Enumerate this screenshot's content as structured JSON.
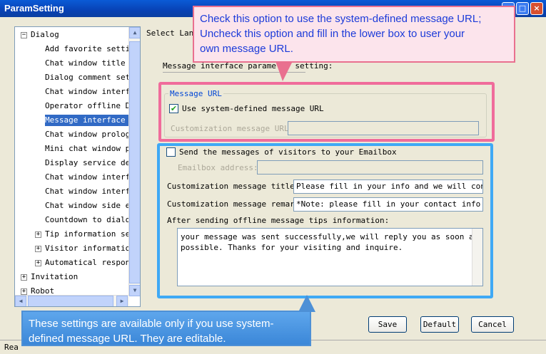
{
  "window": {
    "title": "ParamSetting",
    "min": "_",
    "max": "□",
    "close": "×"
  },
  "tree": {
    "items": [
      {
        "label": "Dialog",
        "expander": "−"
      },
      {
        "label": "Add favorite setting"
      },
      {
        "label": "Chat window title se"
      },
      {
        "label": "Dialog comment setti"
      },
      {
        "label": "Chat window interfac"
      },
      {
        "label": "Operator offline Dis"
      },
      {
        "label": "Message interface se"
      },
      {
        "label": "Chat window prologue"
      },
      {
        "label": "Mini chat window pro"
      },
      {
        "label": "Display service depa"
      },
      {
        "label": "Chat window interfac"
      },
      {
        "label": "Chat window interfac"
      },
      {
        "label": "Chat window side edg"
      },
      {
        "label": "Countdown to dialog"
      },
      {
        "label": "Tip information sett",
        "expander": "+"
      },
      {
        "label": "Visitor information",
        "expander": "+"
      },
      {
        "label": "Automatical response",
        "expander": "+"
      },
      {
        "label": "Invitation",
        "expander": "+"
      },
      {
        "label": "Robot",
        "expander": "+"
      }
    ]
  },
  "lang_label": "Select Lang",
  "section_title": "Message interface parameter setting:",
  "message_url": {
    "legend": "Message URL",
    "checkbox_label": "Use system-defined message URL",
    "checked": true,
    "custom_label": "Customization message URL:",
    "custom_value": ""
  },
  "email": {
    "checkbox_label": "Send the messages of visitors to your Emailbox",
    "checked": false,
    "address_label": "Emailbox address:",
    "address_value": ""
  },
  "title_field": {
    "label": "Customization message title:",
    "value": "Please fill in your info and we will contac"
  },
  "remark_field": {
    "label": "Customization message remark:",
    "value": "*Note: please fill in your contact info ."
  },
  "tips_label": "After sending offline message tips information:",
  "tips_text": "your message was sent successfully,we will reply you as soon as\npossible. Thanks for your visiting and inquire.",
  "buttons": {
    "save": "Save",
    "default": "Default",
    "cancel": "Cancel"
  },
  "status": "Rea",
  "callouts": {
    "pink": "Check this option to use the system-defined message URL;\nUncheck this option and fill in the lower box to user your\nown message URL.",
    "blue": "These settings are available only if you use system-\ndefined message URL. They are editable."
  },
  "colors": {
    "title_bar": "#0842B5",
    "selection": "#316AC5",
    "pink_highlight": "#F06C9B",
    "blue_highlight": "#3FA9F5"
  }
}
